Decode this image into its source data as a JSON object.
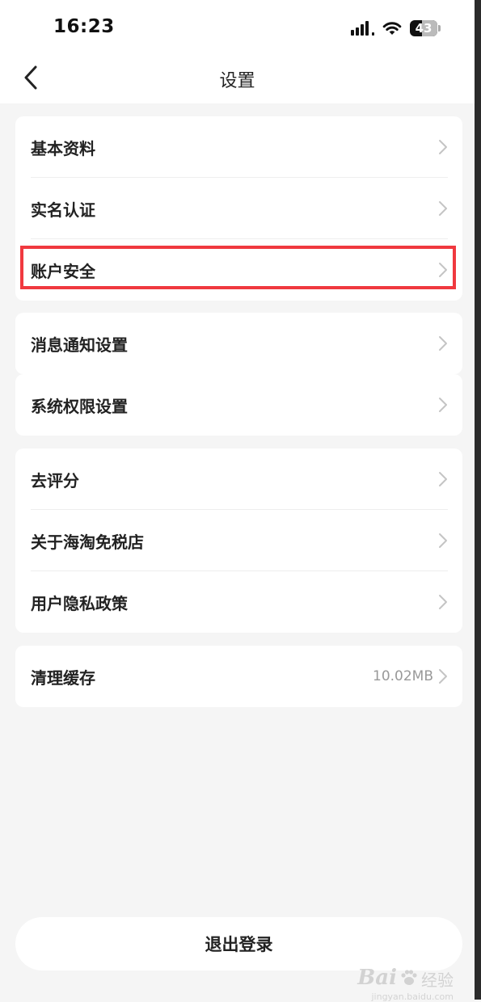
{
  "status_bar": {
    "time": "16:23",
    "battery": "43",
    "icons": [
      "signal-icon",
      "wifi-icon",
      "battery-icon"
    ]
  },
  "nav": {
    "title": "设置",
    "back_icon": "chevron-left-icon"
  },
  "groups": [
    {
      "items": [
        {
          "label": "基本资料"
        },
        {
          "label": "实名认证"
        },
        {
          "label": "账户安全",
          "highlighted": true
        }
      ]
    },
    {
      "items": [
        {
          "label": "消息通知设置"
        },
        {
          "label": "系统权限设置"
        }
      ]
    },
    {
      "items": [
        {
          "label": "去评分"
        },
        {
          "label": "关于海淘免税店"
        },
        {
          "label": "用户隐私政策"
        }
      ]
    },
    {
      "items": [
        {
          "label": "清理缓存",
          "value": "10.02MB"
        }
      ]
    }
  ],
  "logout": {
    "label": "退出登录"
  },
  "watermark": {
    "brand": "Bai",
    "cn": "经验",
    "url": "jingyan.baidu.com"
  },
  "colors": {
    "background": "#f5f5f5",
    "card": "#ffffff",
    "highlight": "#f0393f",
    "chevron": "#c4c4c4"
  }
}
